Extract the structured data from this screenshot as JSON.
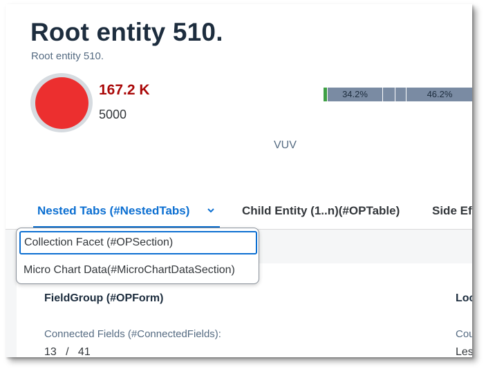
{
  "header": {
    "title": "Root entity 510.",
    "subtitle": "Root entity 510.",
    "kpi": {
      "value": "167.2 K",
      "target": "5000"
    },
    "stacked_bar": {
      "segments": [
        "",
        "34.2%",
        "",
        "",
        "46.2%"
      ]
    },
    "chart_label": "VUV"
  },
  "tabs": [
    {
      "label": "Nested Tabs (#NestedTabs)"
    },
    {
      "label": "Child Entity (1..n)(#OPTable)"
    },
    {
      "label": "Side Ef"
    }
  ],
  "menu": {
    "items": [
      {
        "label": "Collection Facet (#OPSection)"
      },
      {
        "label": "Micro Chart Data(#MicroChartDataSection)"
      }
    ]
  },
  "section": {
    "left_title": "FieldGroup (#OPForm)",
    "right_title": "Loc",
    "field_label": "Connected Fields (#ConnectedFields):",
    "field_value": "13   /   41",
    "right_field_label": "Cou",
    "right_field_value": "Les"
  },
  "colors": {
    "accent": "#0a6ed1",
    "kpi_critical": "#aa0808",
    "avatar": "#ec2f2f",
    "bar_positive": "#3fa045",
    "bar_neutral": "#7a8ba3"
  }
}
